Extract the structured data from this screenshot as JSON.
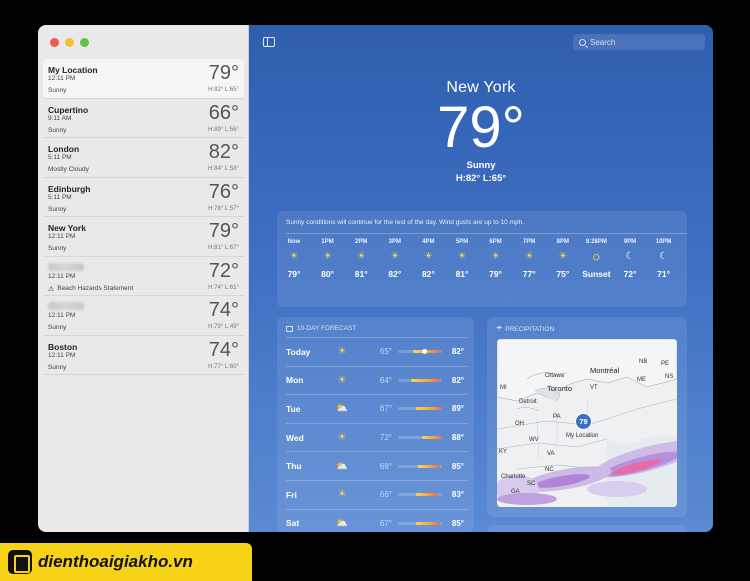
{
  "sidebar": {
    "locations": [
      {
        "name": "My Location",
        "time": "12:11 PM",
        "condition": "Sunny",
        "temp": "79°",
        "hl": "H:82°  L:65°",
        "selected": true
      },
      {
        "name": "Cupertino",
        "time": "9:11 AM",
        "condition": "Sunny",
        "temp": "66°",
        "hl": "H:89°  L:56°"
      },
      {
        "name": "London",
        "time": "5:11 PM",
        "condition": "Mostly Cloudy",
        "temp": "82°",
        "hl": "H:84°  L:58°"
      },
      {
        "name": "Edinburgh",
        "time": "5:11 PM",
        "condition": "Sunny",
        "temp": "76°",
        "hl": "H:78°  L:57°"
      },
      {
        "name": "New York",
        "time": "12:11 PM",
        "condition": "Sunny",
        "temp": "79°",
        "hl": "H:81°  L:67°"
      },
      {
        "name": "",
        "time": "12:11 PM",
        "condition": "Beach Hazards Statement",
        "temp": "72°",
        "hl": "H:74°  L:61°",
        "warning": true
      },
      {
        "name": "",
        "time": "12:11 PM",
        "condition": "Sunny",
        "temp": "74°",
        "hl": "H:79°  L:49°"
      },
      {
        "name": "Boston",
        "time": "12:11 PM",
        "condition": "Sunny",
        "temp": "74°",
        "hl": "H:77°  L:60°"
      }
    ]
  },
  "toolbar": {
    "search_placeholder": "Search"
  },
  "hero": {
    "city": "New York",
    "temp": "79°",
    "condition": "Sunny",
    "hl": "H:82°  L:65°"
  },
  "hourly": {
    "summary": "Sunny conditions will continue for the rest of the day. Wind gusts are up to 10 mph.",
    "hours": [
      {
        "label": "Now",
        "icon": "sun-icon",
        "temp": "79°"
      },
      {
        "label": "1PM",
        "icon": "sun-icon",
        "temp": "80°"
      },
      {
        "label": "2PM",
        "icon": "sun-icon",
        "temp": "81°"
      },
      {
        "label": "3PM",
        "icon": "sun-icon",
        "temp": "82°"
      },
      {
        "label": "4PM",
        "icon": "sun-icon",
        "temp": "82°"
      },
      {
        "label": "5PM",
        "icon": "sun-icon",
        "temp": "81°"
      },
      {
        "label": "6PM",
        "icon": "sun-icon",
        "temp": "79°"
      },
      {
        "label": "7PM",
        "icon": "sun-icon",
        "temp": "77°"
      },
      {
        "label": "8PM",
        "icon": "sun-icon",
        "temp": "75°"
      },
      {
        "label": "8:28PM",
        "icon": "sunset-icon",
        "temp": "Sunset"
      },
      {
        "label": "9PM",
        "icon": "moon-icon",
        "temp": "72°"
      },
      {
        "label": "10PM",
        "icon": "moon-icon",
        "temp": "71°"
      }
    ]
  },
  "forecast": {
    "title": "10-DAY FORECAST",
    "days": [
      {
        "day": "Today",
        "icon": "sun-icon",
        "low": "65°",
        "high": "82°",
        "bar_start": 0.35,
        "bar_end": 0.95,
        "current": 0.6
      },
      {
        "day": "Mon",
        "icon": "sun-icon",
        "low": "64°",
        "high": "82°",
        "bar_start": 0.3,
        "bar_end": 0.95
      },
      {
        "day": "Tue",
        "icon": "partly-cloudy-icon",
        "low": "67°",
        "high": "89°",
        "bar_start": 0.4,
        "bar_end": 1.0
      },
      {
        "day": "Wed",
        "icon": "sun-icon",
        "low": "72°",
        "high": "88°",
        "bar_start": 0.55,
        "bar_end": 1.0
      },
      {
        "day": "Thu",
        "icon": "partly-cloudy-icon",
        "low": "68°",
        "high": "85°",
        "bar_start": 0.45,
        "bar_end": 0.95
      },
      {
        "day": "Fri",
        "icon": "sun-icon",
        "low": "66°",
        "high": "83°",
        "bar_start": 0.4,
        "bar_end": 0.92
      },
      {
        "day": "Sat",
        "icon": "partly-cloudy-icon",
        "low": "67°",
        "high": "85°",
        "bar_start": 0.42,
        "bar_end": 0.95
      }
    ]
  },
  "precipitation": {
    "title": "PRECIPITATION",
    "pin_temp": "79",
    "pin_label": "My Location",
    "map_labels": [
      "NB",
      "PE",
      "NS",
      "Montréal",
      "Ottawa",
      "Toronto",
      "ME",
      "VT",
      "MI",
      "Detroit",
      "PA",
      "OH",
      "WV",
      "VA",
      "KY",
      "NC",
      "SC",
      "GA",
      "Charlotte"
    ]
  },
  "watermark": {
    "text": "dienthoaigiakho.vn"
  },
  "colors": {
    "sun": "#ffd54a",
    "bar_warm": "#f2a444",
    "bar_hot": "#e8685e",
    "accent": "#3b6fb9"
  }
}
